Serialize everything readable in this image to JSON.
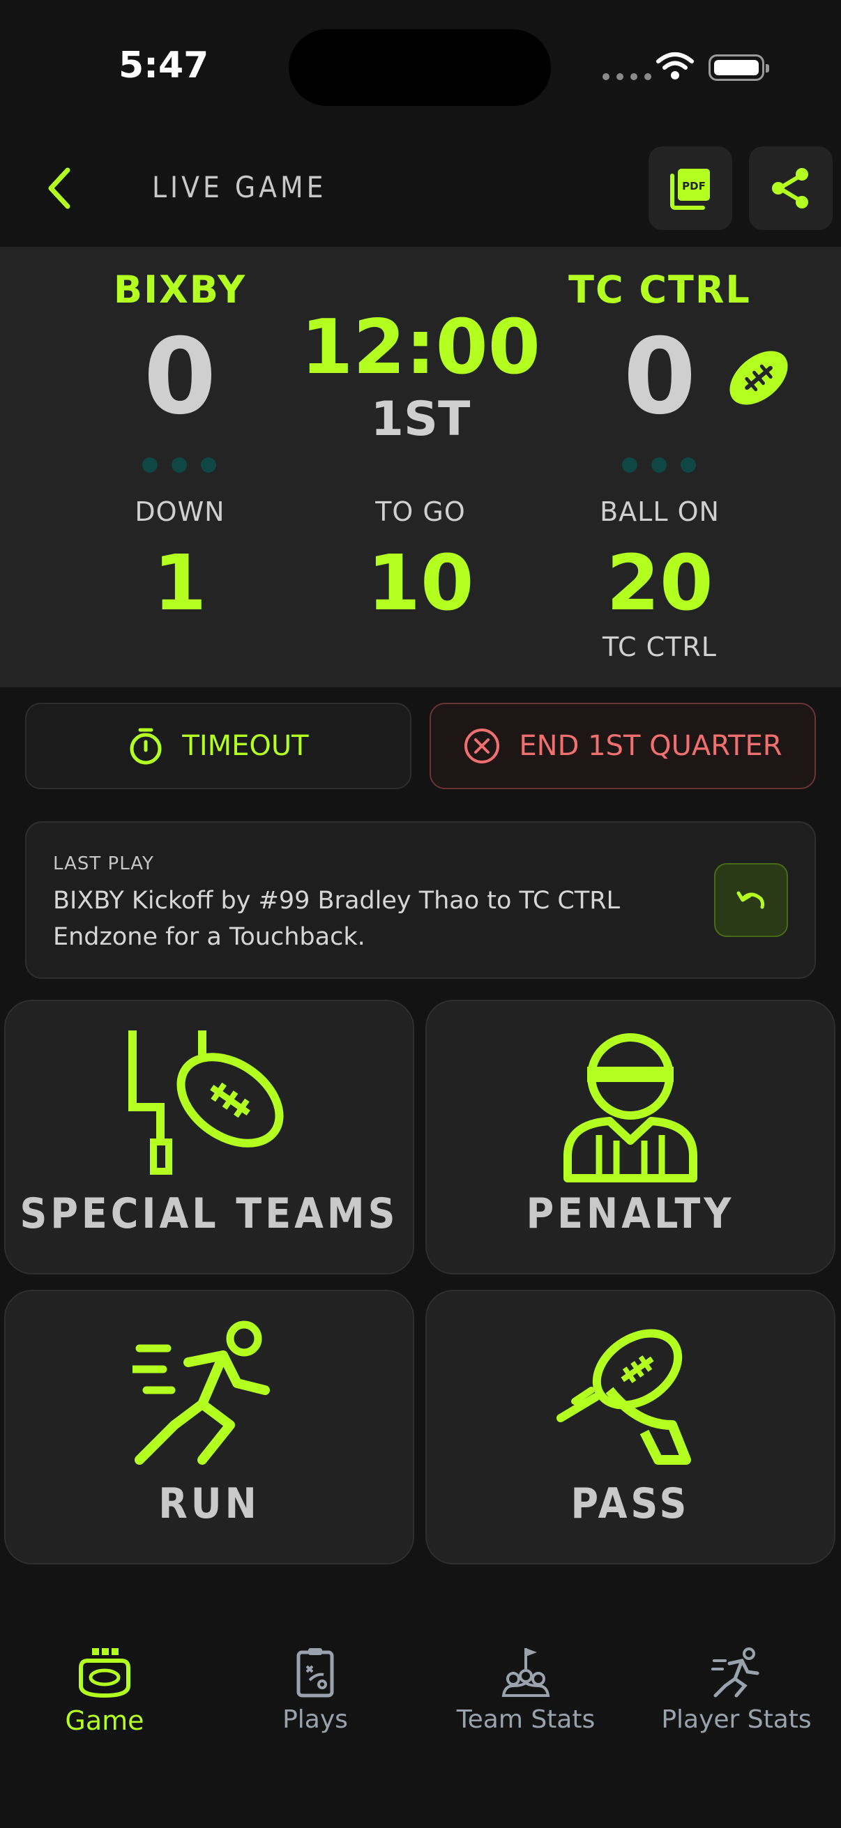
{
  "status_bar": {
    "time": "5:47"
  },
  "header": {
    "title": "LIVE GAME"
  },
  "scoreboard": {
    "home": {
      "name": "BIXBY",
      "score": "0"
    },
    "away": {
      "name": "TC CTRL",
      "score": "0"
    },
    "clock": "12:00",
    "quarter": "1ST",
    "down_label": "DOWN",
    "down_value": "1",
    "togo_label": "TO GO",
    "togo_value": "10",
    "ballon_label": "BALL ON",
    "ballon_value": "20",
    "ballon_team": "TC CTRL"
  },
  "actions": {
    "timeout_label": "TIMEOUT",
    "end_quarter_label": "END 1ST QUARTER"
  },
  "last_play": {
    "label": "LAST PLAY",
    "text": "BIXBY Kickoff by #99 Bradley Thao to TC CTRL Endzone for a Touchback."
  },
  "tiles": {
    "special_teams": "SPECIAL TEAMS",
    "penalty": "PENALTY",
    "run": "RUN",
    "pass": "PASS"
  },
  "tabs": [
    {
      "label": "Game",
      "active": true
    },
    {
      "label": "Plays"
    },
    {
      "label": "Team Stats"
    },
    {
      "label": "Player Stats"
    }
  ],
  "colors": {
    "accent": "#b3ff1f",
    "danger": "#f07070",
    "background": "#131313",
    "panel": "#242424"
  }
}
